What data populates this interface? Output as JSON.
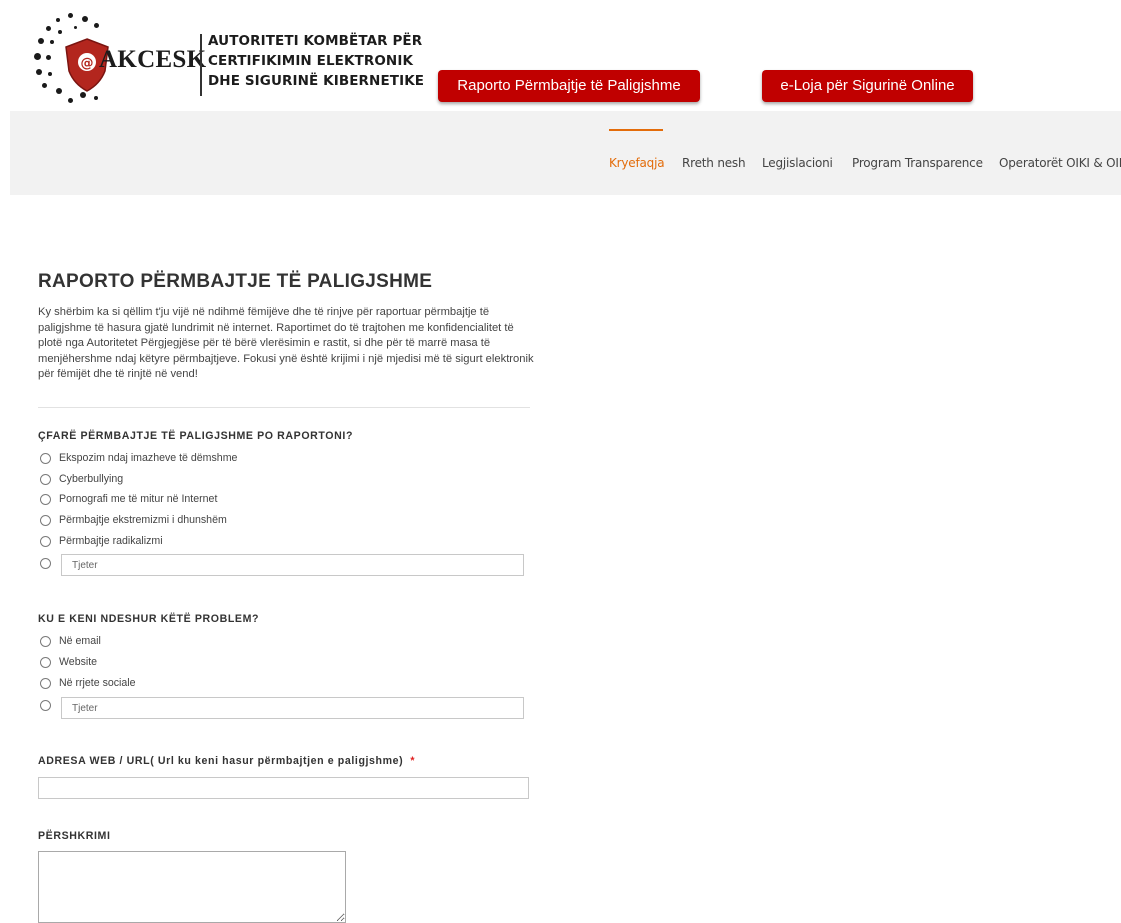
{
  "header": {
    "logo_text": "AKCESK",
    "org_name": [
      "AUTORITETI KOMBËTAR PËR",
      "CERTIFIKIMIN ELEKTRONIK",
      "DHE SIGURINË KIBERNETIKE"
    ],
    "report_button": "Raporto Përmbajtje të Paligjshme",
    "game_button": "e-Loja për Sigurinë Online",
    "colors": {
      "accent": "#e36c0a",
      "button_red": "#c00000"
    }
  },
  "nav": {
    "items": [
      "Kryefaqja",
      "Rreth nesh",
      "Legjislacioni",
      "Program Transparence",
      "Operatorët OIKI & OIR"
    ],
    "active_index": 0
  },
  "form": {
    "title": "RAPORTO PËRMBAJTJE TË PALIGJSHME",
    "intro": "Ky shërbim ka si qëllim t'ju vijë në ndihmë fëmijëve dhe të rinjve për raportuar përmbajtje të paligjshme të hasura gjatë lundrimit në internet. Raportimet do të trajtohen me konfidencialitet të plotë nga Autoritetet Përgjegjëse për të bërë vlerësimin e rastit, si dhe për të marrë masa të menjëhershme ndaj këtyre përmbajtjeve. Fokusi ynë është krijimi i një mjedisi më të sigurt elektronik për fëmijët dhe të rinjtë në vend!",
    "q1": {
      "label": "ÇFARË PËRMBAJTJE TË PALIGJSHME PO RAPORTONI?",
      "options": [
        "Ekspozim ndaj imazheve të dëmshme",
        "Cyberbullying",
        "Pornografi me të mitur në Internet",
        "Përmbajtje ekstremizmi i dhunshëm",
        "Përmbajtje radikalizmi"
      ],
      "other_placeholder": "Tjeter",
      "other_value": ""
    },
    "q2": {
      "label": "KU E KENI NDESHUR KËTË PROBLEM?",
      "options": [
        "Në email",
        "Website",
        "Në rrjete sociale"
      ],
      "other_placeholder": "Tjeter",
      "other_value": ""
    },
    "url": {
      "label": "ADRESA WEB / URL( Url ku keni hasur përmbajtjen e paligjshme)",
      "required_mark": "*",
      "value": ""
    },
    "description": {
      "label": "PËRSHKRIMI",
      "value": ""
    }
  }
}
